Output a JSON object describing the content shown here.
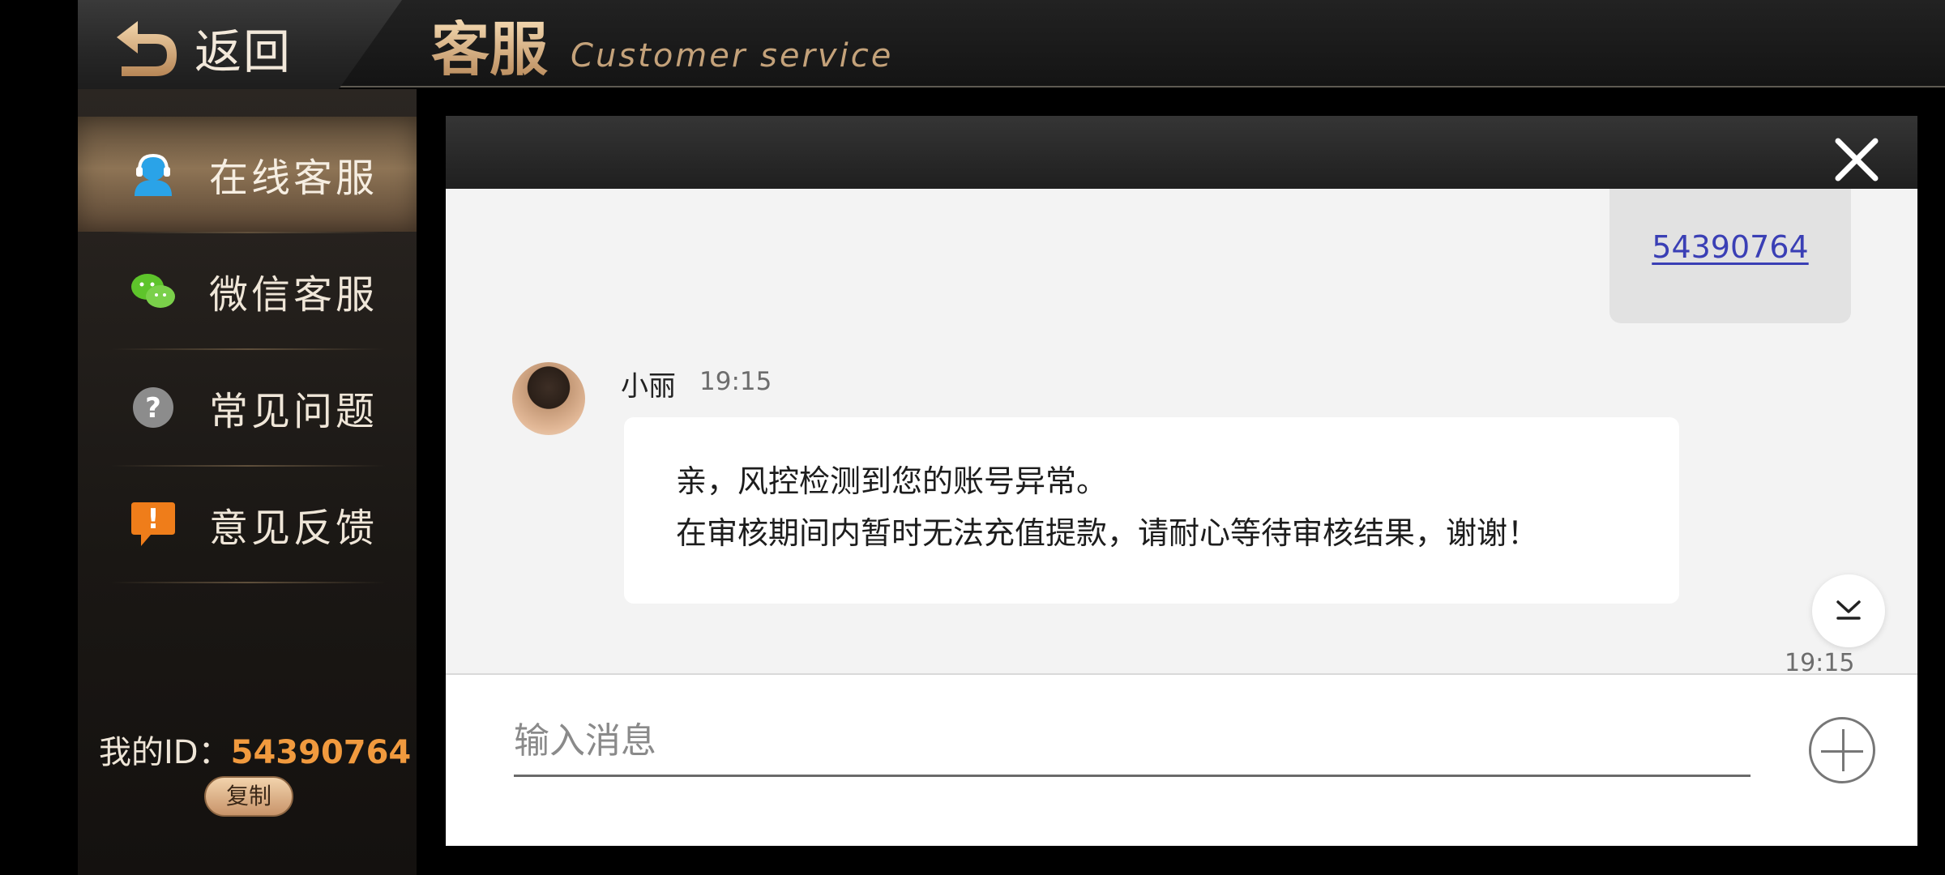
{
  "header": {
    "back_label": "返回",
    "title_cn": "客服",
    "title_en": "Customer service"
  },
  "sidebar": {
    "items": [
      {
        "label": "在线客服",
        "icon": "agent-icon",
        "active": true
      },
      {
        "label": "微信客服",
        "icon": "wechat-icon",
        "active": false
      },
      {
        "label": "常见问题",
        "icon": "question-icon",
        "active": false
      },
      {
        "label": "意见反馈",
        "icon": "feedback-icon",
        "active": false
      }
    ],
    "my_id_label": "我的ID：",
    "my_id_value": "54390764",
    "copy_label": "复制"
  },
  "chat": {
    "sent_message": "54390764",
    "sender_name": "小丽",
    "sender_time": "19:15",
    "received_lines": [
      "亲，风控检测到您的账号异常。",
      "在审核期间内暂时无法充值提款，请耐心等待审核结果，谢谢！"
    ],
    "bottom_time": "19:15"
  },
  "input": {
    "placeholder": "输入消息"
  },
  "colors": {
    "accent_gold": "#d9b58a",
    "id_orange": "#f19a3e",
    "link_blue": "#3a3fb5",
    "chat_bg": "#f3f3f3"
  }
}
